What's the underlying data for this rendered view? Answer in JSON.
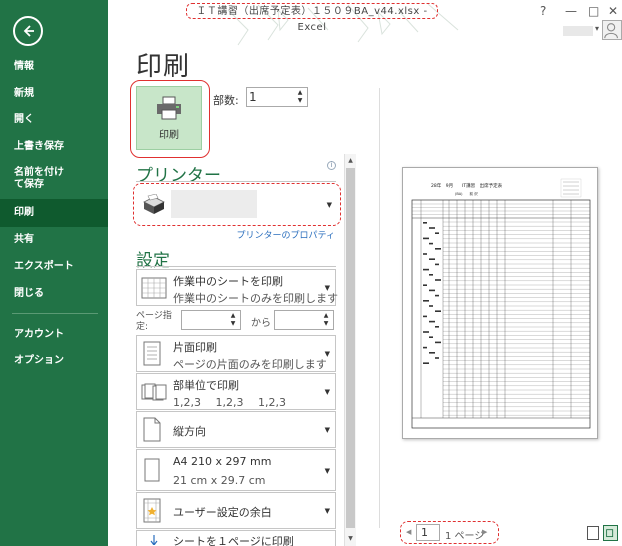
{
  "window": {
    "title": "ＩＴ講習（出席予定表）１５０９BA_v44.xlsx - Excel",
    "help": "?",
    "minimize": "—",
    "maximize": "□",
    "close": "✕"
  },
  "sidebar": {
    "items": [
      {
        "label": "情報"
      },
      {
        "label": "新規"
      },
      {
        "label": "開く"
      },
      {
        "label": "上書き保存"
      },
      {
        "label": "名前を付けて保存"
      },
      {
        "label": "印刷",
        "selected": true
      },
      {
        "label": "共有"
      },
      {
        "label": "エクスポート"
      },
      {
        "label": "閉じる"
      },
      {
        "label": "アカウント"
      },
      {
        "label": "オプション"
      }
    ]
  },
  "print": {
    "heading": "印刷",
    "button_label": "印刷",
    "copies_label": "部数:",
    "copies_value": "1"
  },
  "printer": {
    "heading": "プリンター",
    "info": "i",
    "properties_link": "プリンターのプロパティ"
  },
  "settings": {
    "heading": "設定",
    "scope": {
      "line1": "作業中のシートを印刷",
      "line2": "作業中のシートのみを印刷します"
    },
    "pages": {
      "label": "ページ指定:",
      "to": "から"
    },
    "sides": {
      "line1": "片面印刷",
      "line2": "ページの片面のみを印刷します"
    },
    "collate": {
      "line1": "部単位で印刷",
      "line2": "1,2,3　 1,2,3　 1,2,3"
    },
    "orientation": {
      "line1": "縦方向"
    },
    "paper": {
      "line1": "A4 210 x 297 mm",
      "line2": "21 cm x 29.7 cm"
    },
    "margins": {
      "line1": "ユーザー設定の余白"
    },
    "scaling": {
      "line1": "シートを１ページに印刷"
    }
  },
  "pager": {
    "current": "1",
    "total": "1 ページ",
    "prev": "◀",
    "next": "▶"
  },
  "preview": {
    "header_line": "28年　9月　　IT講習　出席予定表",
    "sub_line": "(BA)　　前 沢"
  },
  "colors": {
    "accent": "#217346",
    "annotation": "#e03030",
    "link": "#2a6ebd"
  }
}
